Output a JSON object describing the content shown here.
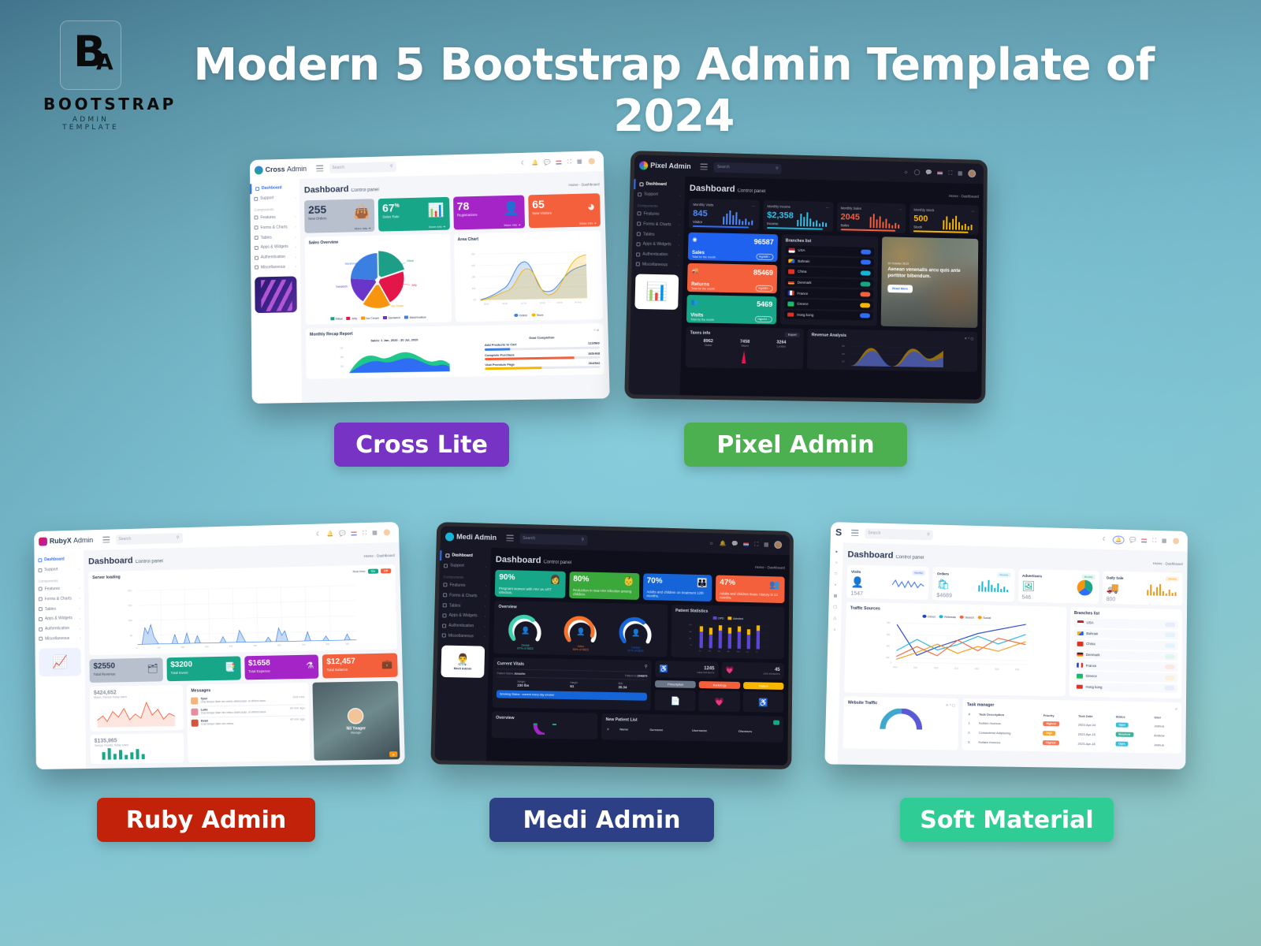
{
  "page": {
    "title": "Modern 5 Bootstrap Admin Template of 2024",
    "logo": {
      "mark_b": "B",
      "mark_a": "A",
      "line1": "BOOTSTRAP",
      "line2": "ADMIN TEMPLATE"
    },
    "background": {
      "top_left": "#3d6e87",
      "center": "#7cc4d4",
      "bottom_right": "#8fc0ba"
    }
  },
  "labels": {
    "cross": {
      "text": "Cross Lite",
      "color": "#7733c4"
    },
    "pixel": {
      "text": "Pixel Admin",
      "color": "#4caf50"
    },
    "ruby": {
      "text": "Ruby Admin",
      "color": "#c22209"
    },
    "medi": {
      "text": "Medi Admin",
      "color": "#2d3f85"
    },
    "soft": {
      "text": "Soft Material",
      "color": "#2fcc95"
    }
  },
  "common": {
    "search_placeholder": "Search",
    "dashboard_title": "Dashboard",
    "dashboard_subtitle": "Control panel",
    "breadcrumb": "Home - Dashboard",
    "sidebar": [
      {
        "label": "Dashboard",
        "active": true,
        "arrow": ""
      },
      {
        "label": "Support",
        "active": false,
        "arrow": "›"
      },
      {
        "label": "Components",
        "header": true
      },
      {
        "label": "Features",
        "active": false,
        "arrow": "›"
      },
      {
        "label": "Forms & Charts",
        "active": false,
        "arrow": "›"
      },
      {
        "label": "Tables",
        "active": false,
        "arrow": "›"
      },
      {
        "label": "Apps & Widgets",
        "active": false,
        "arrow": "›"
      },
      {
        "label": "Authentication",
        "active": false,
        "arrow": "›"
      },
      {
        "label": "Miscellaneous",
        "active": false,
        "arrow": "›"
      }
    ],
    "header_icons": [
      "moon-icon",
      "bell-icon",
      "chat-icon",
      "flag-icon",
      "fullscreen-icon",
      "grid-icon",
      "avatar"
    ]
  },
  "cross": {
    "brand": "Cross",
    "brand_light": "Admin",
    "stats": [
      {
        "num": "255",
        "sup": "",
        "label": "New Orders",
        "more": "More info ➔",
        "color": "#b9c0cd",
        "glyph": "👜",
        "text": "#2b3a55"
      },
      {
        "num": "67",
        "sup": "%",
        "label": "Sales Rate",
        "more": "More info ➔",
        "color": "#18a688",
        "glyph": "📊",
        "text": "#ffffff"
      },
      {
        "num": "78",
        "sup": "",
        "label": "Registrations",
        "more": "More info ➔",
        "color": "#a424c7",
        "glyph": "👤",
        "text": "#ffffff"
      },
      {
        "num": "65",
        "sup": "",
        "label": "New Visitors",
        "more": "More info ➔",
        "color": "#f5603c",
        "glyph": "◕",
        "text": "#ffffff"
      }
    ],
    "sales_overview": {
      "title": "Sales Overview",
      "slices": [
        {
          "name": "Kitkat",
          "value": 24,
          "color": "#1d9e86"
        },
        {
          "name": "Jelly",
          "value": 19,
          "color": "#e3164a"
        },
        {
          "name": "Ice Cream",
          "value": 21,
          "color": "#f7960e"
        },
        {
          "name": "Sandwich",
          "value": 17,
          "color": "#6a35c9"
        },
        {
          "name": "Marshmallow",
          "value": 19,
          "color": "#3b7fe0"
        }
      ]
    },
    "area_chart": {
      "title": "Area Chart",
      "legend": [
        {
          "name": "Online",
          "color": "#3b7fe0"
        },
        {
          "name": "Store",
          "color": "#f7b600"
        }
      ],
      "x_ticks": [
        "18:00",
        "20:00",
        "21:30",
        "22:00",
        "23:00",
        "14 Sep"
      ],
      "y_ticks": [
        "250",
        "200",
        "150",
        "100",
        "50",
        "0"
      ]
    },
    "recap": {
      "title": "Monthly Recap Report",
      "sales_label": "Sales: 1 Jan, 2020 - 30 Jul, 2020",
      "goal_title": "Goal Completion",
      "goals": [
        {
          "label": "Add Products to Cart",
          "value": "123/569",
          "pct": 22,
          "color": "#3b7fe0"
        },
        {
          "label": "Complete Purchase",
          "value": "365/468",
          "pct": 78,
          "color": "#f5603c"
        },
        {
          "label": "Visit Premium Page",
          "value": "264/542",
          "pct": 49,
          "color": "#f7b600"
        }
      ]
    }
  },
  "pixel": {
    "brand": "Pixel Admin",
    "stats": [
      {
        "label": "Monthly Visits",
        "num": "845",
        "sub": "Visitor",
        "color": "#2f6df5"
      },
      {
        "label": "Monthly Income",
        "num": "$2,358",
        "sub": "Income",
        "color": "#18b4d8"
      },
      {
        "label": "Monthly Sales",
        "num": "2045",
        "sub": "Sales",
        "color": "#f5603c"
      },
      {
        "label": "Monthly Stock",
        "num": "500",
        "sub": "Stock",
        "color": "#f7b600"
      }
    ],
    "tiles": [
      {
        "title": "Sales",
        "sub": "Total for the month",
        "value": "96587",
        "badge": "High489 ↑",
        "color": "#1f62ef",
        "glyph": "◉"
      },
      {
        "title": "Returns",
        "sub": "Total for the month",
        "value": "85469",
        "badge": "High583 ↑",
        "color": "#f5603c",
        "glyph": "🚚"
      },
      {
        "title": "Visits",
        "sub": "Total for the month",
        "value": "5469",
        "badge": "High401 ↑",
        "color": "#18a688",
        "glyph": "👥"
      }
    ],
    "branches_title": "Branches list",
    "branches": [
      {
        "name": "USA",
        "color": "#2f6df5"
      },
      {
        "name": "Bahrain",
        "color": "#2f6df5"
      },
      {
        "name": "China",
        "color": "#18b4d8"
      },
      {
        "name": "Denmark",
        "color": "#18a688"
      },
      {
        "name": "France",
        "color": "#f5603c"
      },
      {
        "name": "Greece",
        "color": "#f7b600"
      },
      {
        "name": "Hong kong",
        "color": "#2f6df5"
      }
    ],
    "promo": {
      "date": "22 October 2019",
      "text": "Aenean venenatis arcu quis ante porttitor bibendum.",
      "button": "Read More"
    },
    "taxes": {
      "title": "Taxes info",
      "button": "Export",
      "items": [
        {
          "num": "8962",
          "label": "Dubai"
        },
        {
          "num": "7458",
          "label": "Miami"
        },
        {
          "num": "3264",
          "label": "London"
        }
      ]
    },
    "revenue": {
      "title": "Revenue Analysis",
      "y_ticks": [
        "250",
        "200",
        "150"
      ]
    }
  },
  "ruby": {
    "brand": "RubyX",
    "brand_light": "Admin",
    "server": {
      "title": "Server loading",
      "realtime_label": "Real time",
      "on": "On",
      "off": "Off",
      "y_ticks": [
        "200",
        "150",
        "100",
        "50",
        "0"
      ],
      "x_ticks": [
        "0",
        "100",
        "200",
        "300",
        "400",
        "500",
        "600",
        "700",
        "800",
        "900"
      ]
    },
    "stats": [
      {
        "num": "$2550",
        "label": "Total Revenue",
        "color": "#b9c0cd",
        "glyph": "🗂",
        "text": "#2b3a55"
      },
      {
        "num": "$3200",
        "label": "Total Invest",
        "color": "#18a688",
        "glyph": "📑",
        "text": "#ffffff"
      },
      {
        "num": "$1658",
        "label": "Total Expence",
        "color": "#a424c7",
        "glyph": "⚗",
        "text": "#ffffff"
      },
      {
        "num": "$12,457",
        "label": "Total Balance",
        "color": "#f5603c",
        "glyph": "💼",
        "text": "#ffffff"
      }
    ],
    "sales_cards": [
      {
        "num": "$424,652",
        "label": "Miami, Florida Today sales"
      },
      {
        "num": "$135,965",
        "label": "Tampa, Florida Today sales"
      }
    ],
    "messages": {
      "title": "Messages",
      "items": [
        {
          "name": "Tyler",
          "time": "Just now",
          "text": "Cras tempor diam nec metus ullamcorper, ut ultrices lacus."
        },
        {
          "name": "Luke",
          "time": "30 min ago",
          "text": "Cras tempor diam nec metus ullamcorper, ut ultrices lacus."
        },
        {
          "name": "Evan",
          "time": "40 min ago",
          "text": "Cras tempor diam nec metus."
        }
      ]
    },
    "profile": {
      "name": "Nil Yeager",
      "role": "Manager"
    }
  },
  "medi": {
    "brand": "Medi Admin",
    "stats": [
      {
        "num": "90%",
        "desc": "Pregnant women with HIV on ART infection.",
        "color": "#18a688"
      },
      {
        "num": "80%",
        "desc": "Reduction in new HIV infection among children.",
        "color": "#3aa83a"
      },
      {
        "num": "70%",
        "desc": "Adults and children on treatment 12th months.",
        "color": "#1565d8"
      },
      {
        "num": "47%",
        "desc": "Adults and children fewer History in 12 months.",
        "color": "#f5603c"
      }
    ],
    "overview": {
      "title": "Overview",
      "gauges": [
        {
          "name": "Dental",
          "pct": 67,
          "caption": "67% of 5823",
          "color": "#3fd0ac"
        },
        {
          "name": "Ortho",
          "pct": 85,
          "caption": "85% of 5823",
          "color": "#f7722a"
        },
        {
          "name": "Cardiac",
          "pct": 67,
          "caption": "67% of 5823",
          "color": "#1565d8"
        }
      ]
    },
    "patient_stats": {
      "title": "Patient Statistics",
      "legend": [
        {
          "name": "OPD",
          "color": "#5b47d6"
        },
        {
          "name": "Admited",
          "color": "#f7b600"
        }
      ],
      "x_ticks": [
        "Jan",
        "Feb",
        "Mar",
        "Apr",
        "May",
        "Jun",
        "Jul"
      ],
      "y_ticks": [
        "200",
        "150",
        "100",
        "50",
        "0"
      ]
    },
    "vitals": {
      "title": "Current Vitals",
      "patient_name_label": "Patient Name",
      "patient_name": "Jonsohn",
      "patient_id_label": "Patient Id",
      "patient_id": "1546879",
      "metrics": [
        {
          "label": "Weight",
          "value": "230 lbs"
        },
        {
          "label": "Height",
          "value": "61"
        },
        {
          "label": "BMI",
          "value": "30.34"
        }
      ],
      "smoking": "Smoking Status : current every day smoker"
    },
    "counters": [
      {
        "num": "1245",
        "label": "NEW PATIENTS"
      },
      {
        "num": "45",
        "label": "OPD PATIENTS"
      }
    ],
    "actions": [
      {
        "label": "Prescription",
        "color": "#6b7588"
      },
      {
        "label": "Radiology",
        "color": "#f5603c"
      },
      {
        "label": "Patient",
        "color": "#f7b600"
      }
    ],
    "bottom_panels": [
      "Overview",
      "New Patient List"
    ],
    "patient_cols": [
      "#",
      "Name",
      "Surname",
      "Username",
      "Diseases"
    ]
  },
  "soft": {
    "brand": "S",
    "stats": [
      {
        "label": "Visits",
        "badge": "Monthly",
        "value": "1547",
        "icon": "user-icon",
        "color": "#2f6df5"
      },
      {
        "label": "Orders",
        "badge": "Monthly",
        "value": "$4689",
        "icon": "bag-icon",
        "color": "#18b4d8"
      },
      {
        "label": "Advertisers",
        "badge": "Monthly",
        "value": "546",
        "icon": "image-icon",
        "color": "#18a688"
      },
      {
        "label": "Daily Sale",
        "badge": "Monthly",
        "value": "800",
        "icon": "truck-icon",
        "color": "#f7960e"
      }
    ],
    "traffic": {
      "title": "Traffic Sources",
      "legend": [
        {
          "name": "Direct",
          "color": "#1f3fbf"
        },
        {
          "name": "Referrals",
          "color": "#18b4d8"
        },
        {
          "name": "Search",
          "color": "#f5603c"
        },
        {
          "name": "Social",
          "color": "#f7960e"
        }
      ],
      "x_ticks": [
        "2010",
        "2011",
        "2012",
        "2013",
        "2014",
        "2015",
        "2016"
      ],
      "y_ticks": [
        "800",
        "600",
        "400",
        "200",
        "0"
      ]
    },
    "branches_title": "Branches list",
    "branches": [
      "USA",
      "Bahrain",
      "China",
      "Denmark",
      "France",
      "Greece",
      "Hong kong"
    ],
    "website_traffic": {
      "title": "Website Traffic"
    },
    "task_manager": {
      "title": "Task manager",
      "columns": [
        "#",
        "Task Description",
        "Priority",
        "Task Date",
        "Status",
        "User"
      ],
      "rows": [
        {
          "n": "1.",
          "desc": "Nullam rhoncus",
          "priority": "Highest",
          "priority_color": "#f5603c",
          "date": "2023-Apr-04",
          "status": "Open",
          "status_color": "#18b4d8",
          "user": "Joshua"
        },
        {
          "n": "2.",
          "desc": "Consectetur Adipiscing",
          "priority": "High",
          "priority_color": "#f7960e",
          "date": "2023-Apr-15",
          "status": "Resolved",
          "status_color": "#18a688",
          "user": "Andrew"
        },
        {
          "n": "3.",
          "desc": "Nullam rhoncus",
          "priority": "Highest",
          "priority_color": "#f5603c",
          "date": "2023-Apr-18",
          "status": "Open",
          "status_color": "#18b4d8",
          "user": "Joshua"
        }
      ]
    }
  }
}
